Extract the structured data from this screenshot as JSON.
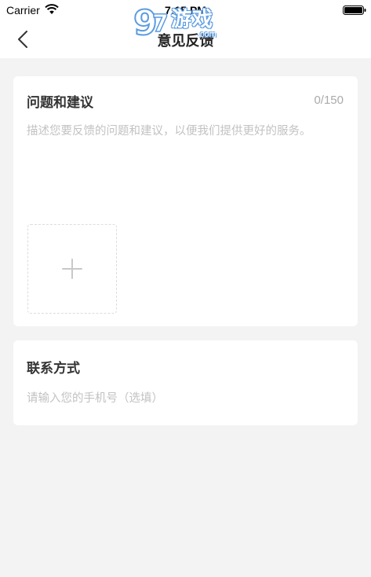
{
  "status_bar": {
    "carrier": "Carrier",
    "time": "7:15 PM"
  },
  "nav": {
    "title": "意见反馈",
    "back_icon": "chevron-left-icon"
  },
  "watermark": {
    "brand": "游戏",
    "domain": ".com"
  },
  "feedback": {
    "title": "问题和建议",
    "count": "0/150",
    "placeholder": "描述您要反馈的问题和建议，以便我们提供更好的服务。",
    "value": "",
    "upload_icon": "plus-icon"
  },
  "contact": {
    "title": "联系方式",
    "placeholder": "请输入您的手机号（选填）",
    "value": ""
  },
  "colors": {
    "background": "#f3f3f3",
    "card": "#ffffff",
    "placeholder": "#c2c2c2",
    "watermark_outline": "#5b9be0"
  }
}
